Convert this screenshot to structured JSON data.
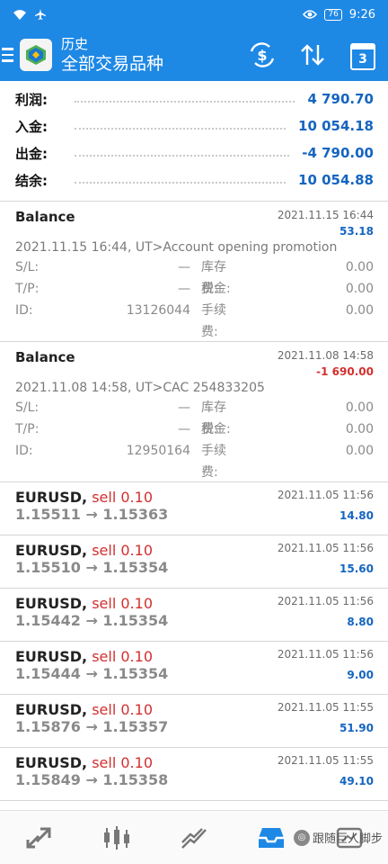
{
  "status": {
    "time": "9:26",
    "battery": "76"
  },
  "header": {
    "title": "历史",
    "subtitle": "全部交易品种"
  },
  "summary": [
    {
      "label": "利润:",
      "value": "4 790.70"
    },
    {
      "label": "入金:",
      "value": "10 054.18"
    },
    {
      "label": "出金:",
      "value": "-4 790.00"
    },
    {
      "label": "结余:",
      "value": "10 054.88"
    }
  ],
  "balances": [
    {
      "name": "Balance",
      "date": "2021.11.15 16:44",
      "amount": "53.18",
      "comment": "2021.11.15 16:44, UT>Account opening promotion",
      "sl_label": "S/L:",
      "sl": "—",
      "storage_label": "库存费:",
      "storage": "0.00",
      "tp_label": "T/P:",
      "tp": "—",
      "tax_label": "税金:",
      "tax": "0.00",
      "id_label": "ID:",
      "id": "13126044",
      "fee_label": "手续费:",
      "fee": "0.00"
    },
    {
      "name": "Balance",
      "date": "2021.11.08 14:58",
      "amount": "-1 690.00",
      "comment": "2021.11.08 14:58, UT>CAC 254833205",
      "sl_label": "S/L:",
      "sl": "—",
      "storage_label": "库存费:",
      "storage": "0.00",
      "tp_label": "T/P:",
      "tp": "—",
      "tax_label": "税金:",
      "tax": "0.00",
      "id_label": "ID:",
      "id": "12950164",
      "fee_label": "手续费:",
      "fee": "0.00"
    }
  ],
  "trades": [
    {
      "symbol": "EURUSD,",
      "type": "sell 0.10",
      "prices": "1.15511 → 1.15363",
      "date": "2021.11.05 11:56",
      "profit": "14.80"
    },
    {
      "symbol": "EURUSD,",
      "type": "sell 0.10",
      "prices": "1.15510 → 1.15354",
      "date": "2021.11.05 11:56",
      "profit": "15.60"
    },
    {
      "symbol": "EURUSD,",
      "type": "sell 0.10",
      "prices": "1.15442 → 1.15354",
      "date": "2021.11.05 11:56",
      "profit": "8.80"
    },
    {
      "symbol": "EURUSD,",
      "type": "sell 0.10",
      "prices": "1.15444 → 1.15354",
      "date": "2021.11.05 11:56",
      "profit": "9.00"
    },
    {
      "symbol": "EURUSD,",
      "type": "sell 0.10",
      "prices": "1.15876 → 1.15357",
      "date": "2021.11.05 11:55",
      "profit": "51.90"
    },
    {
      "symbol": "EURUSD,",
      "type": "sell 0.10",
      "prices": "1.15849 → 1.15358",
      "date": "2021.11.05 11:55",
      "profit": "49.10"
    }
  ],
  "calendar_day": "3",
  "watermark": "跟随巨人脚步",
  "colors": {
    "primary": "#1e88e5",
    "positive": "#1565c0",
    "negative": "#d32f2f"
  },
  "icons": [
    "wifi-icon",
    "airplane-icon",
    "eye-icon",
    "battery-icon",
    "menu-icon",
    "app-logo",
    "currency-exchange-icon",
    "sort-icon",
    "calendar-icon",
    "quotes-icon",
    "chart-icon",
    "trade-icon",
    "history-icon",
    "messages-icon"
  ]
}
